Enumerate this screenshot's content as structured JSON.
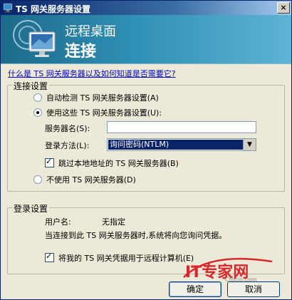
{
  "window": {
    "title": "TS 网关服务器设置",
    "close_glyph": "×"
  },
  "banner": {
    "subtitle": "远程桌面",
    "title": "连接"
  },
  "help_link": "什么是 TS 网关服务器以及如何知道是否需要它?",
  "connection_settings": {
    "group_title": "连接设置",
    "auto_detect_label": "自动检测 TS 网关服务器设置(A)",
    "use_these_label": "使用这些 TS 网关服务器设置(U):",
    "server_name_label": "服务器名(S):",
    "server_name_value": "",
    "logon_method_label": "登录方法(L):",
    "logon_method_value": "询问密码(NTLM)",
    "bypass_local_label": "跳过本地地址的 TS 网关服务器(B)",
    "do_not_use_label": "不使用 TS 网关服务器(D)",
    "selected_option": "use_these",
    "bypass_local_checked": true
  },
  "logon_settings": {
    "group_title": "登录设置",
    "username_label": "用户名:",
    "username_value": "无指定",
    "info_text": "当连接到此 TS 网关服务器时,系统将向您询问凭据。",
    "use_credentials_label": "将我的 TS 网关凭据用于远程计算机(E)",
    "use_credentials_checked": true
  },
  "buttons": {
    "ok": "确定",
    "cancel": "取消"
  },
  "watermark": {
    "brand": "IT专家网",
    "site": "Ctocio.com"
  },
  "colors": {
    "titlebar": "#0a246a",
    "banner": "#2f8fb4",
    "selection": "#0a246a",
    "watermark_red": "#d9262b"
  }
}
